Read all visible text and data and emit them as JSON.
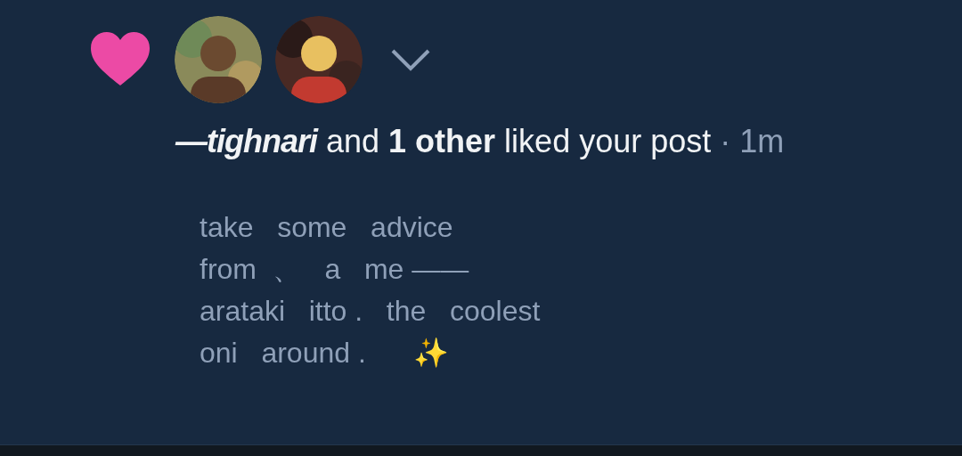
{
  "notification": {
    "liked": true,
    "actor": "—tighnari",
    "action": "and **1 other** liked your post",
    "time": "· 1m",
    "post_lines": [
      "take   some   advice",
      "from  、   a   me ——",
      "arataki   itto .   the   coolest",
      "oni   around .      ✨"
    ]
  }
}
